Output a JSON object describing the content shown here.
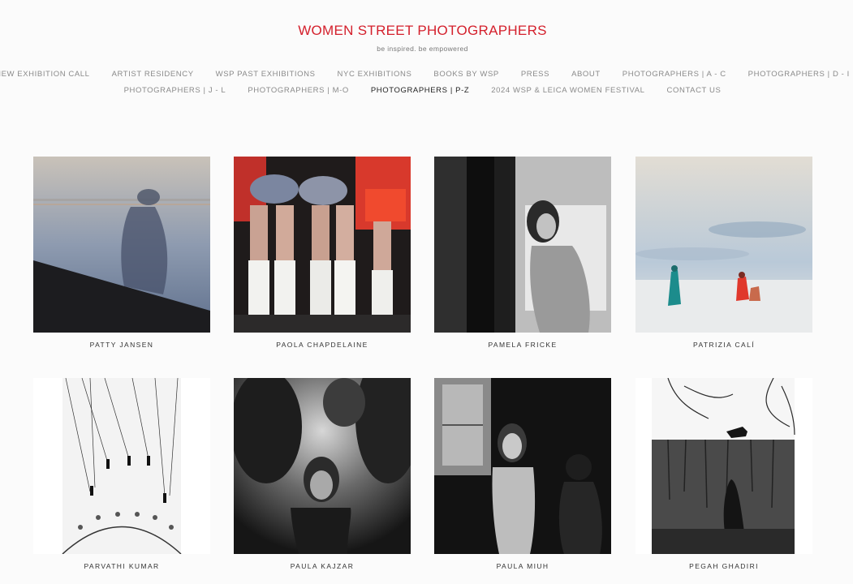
{
  "site": {
    "title": "WOMEN STREET PHOTOGRAPHERS",
    "tagline": "be inspired. be empowered"
  },
  "nav": {
    "row1": [
      "NEW EXHIBITION CALL",
      "ARTIST RESIDENCY",
      "WSP PAST EXHIBITIONS",
      "NYC EXHIBITIONS",
      "BOOKS BY WSP",
      "PRESS",
      "ABOUT",
      "PHOTOGRAPHERS | A - C",
      "PHOTOGRAPHERS | D - I"
    ],
    "row2": [
      "PHOTOGRAPHERS | J - L",
      "PHOTOGRAPHERS | M-O",
      "PHOTOGRAPHERS | P-Z",
      "2024 WSP & LEICA WOMEN FESTIVAL",
      "CONTACT US"
    ],
    "active": "PHOTOGRAPHERS | P-Z"
  },
  "gallery": [
    {
      "name": "PATTY JANSEN",
      "subject": "shadow-wall"
    },
    {
      "name": "PAOLA CHAPDELAINE",
      "subject": "dancers-boots"
    },
    {
      "name": "PAMELA FRICKE",
      "subject": "woman-window"
    },
    {
      "name": "PATRIZIA CALÍ",
      "subject": "sea-figures"
    },
    {
      "name": "PARVATHI KUMAR",
      "subject": "swing-ride"
    },
    {
      "name": "PAULA KAJZAR",
      "subject": "girl-crowd"
    },
    {
      "name": "PAULA MIUH",
      "subject": "girl-children"
    },
    {
      "name": "PEGAH GHADIRI",
      "subject": "cat-wall"
    }
  ]
}
